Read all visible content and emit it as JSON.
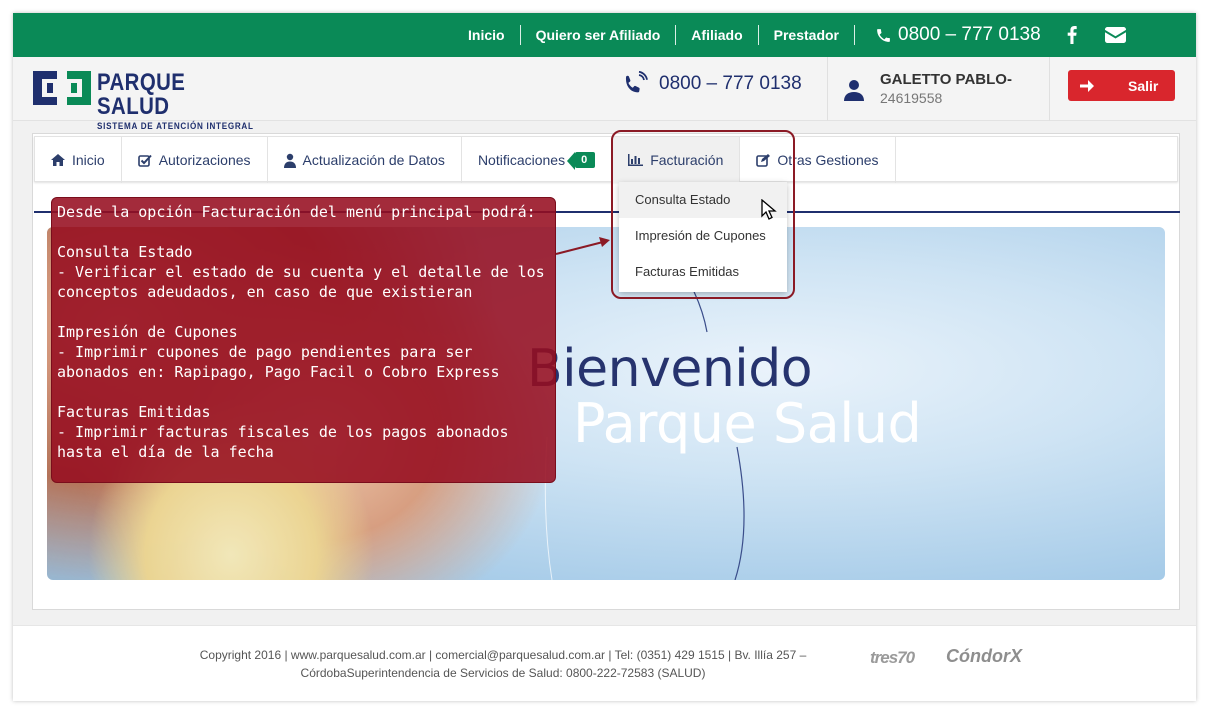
{
  "topbar": {
    "links": [
      "Inicio",
      "Quiero ser Afiliado",
      "Afiliado",
      "Prestador"
    ],
    "phone": "0800 – 777 0138",
    "bg_color": "#0a8a57",
    "icons": [
      "phone-icon",
      "facebook-icon",
      "envelope-icon"
    ]
  },
  "header": {
    "logo_title": "PARQUE SALUD",
    "logo_subtitle": "SISTEMA DE ATENCIÓN INTEGRAL",
    "phone": "0800 – 777 0138",
    "user_name": "GALETTO PABLO-",
    "user_id": "24619558",
    "logout_label": "Salir",
    "logout_color": "#d9262d"
  },
  "menu": {
    "items": [
      {
        "label": "Inicio",
        "icon": "home-icon"
      },
      {
        "label": "Autorizaciones",
        "icon": "check-square-icon"
      },
      {
        "label": "Actualización de Datos",
        "icon": "user-icon"
      },
      {
        "label": "Notificaciones",
        "icon": ""
      },
      {
        "label": "Facturación",
        "icon": "bar-chart-icon"
      },
      {
        "label": "Otras Gestiones",
        "icon": "edit-icon"
      }
    ],
    "notifications_count": "0",
    "dropdown": [
      "Consulta Estado",
      "Impresión de Cupones",
      "Facturas Emitidas"
    ]
  },
  "hero": {
    "line1": "Bienvenido",
    "line2": "Parque Salud"
  },
  "callout": {
    "text": "Desde la opción Facturación del menú principal podrá:\n\nConsulta Estado\n- Verificar el estado de su cuenta y el detalle de los conceptos adeudados, en caso de que existieran\n\nImpresión de Cupones\n- Imprimir cupones de pago pendientes para ser abonados en: Rapipago, Pago Facil o Cobro Express\n\nFacturas Emitidas\n- Imprimir facturas fiscales de los pagos abonados hasta el día de la fecha"
  },
  "footer": {
    "copyright": "Copyright 2016 | www.parquesalud.com.ar | comercial@parquesalud.com.ar | Tel: (0351) 429 1515 | Bv. Illía 257 – CórdobaSuperintendencia de Servicios de Salud: 0800-222-72583 (SALUD)",
    "brand1": "tres70",
    "brand2": "CóndorX"
  }
}
